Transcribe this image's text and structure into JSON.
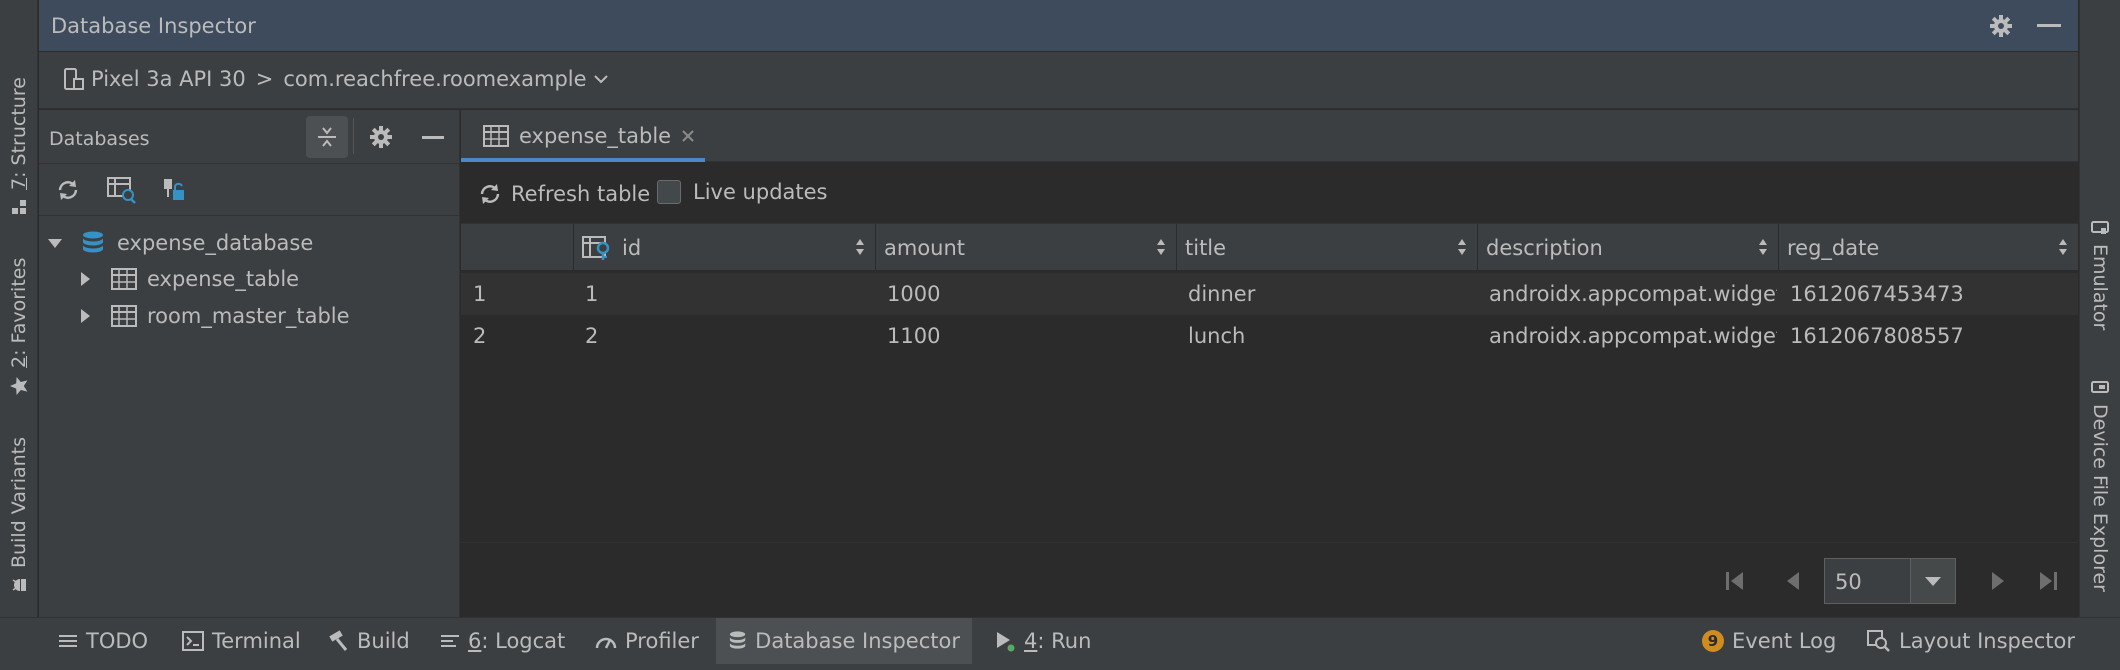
{
  "window": {
    "title": "Database Inspector"
  },
  "left_stripe": {
    "tabs": [
      {
        "num": "7",
        "label": ": Structure",
        "icon": "structure-icon"
      },
      {
        "num": "2",
        "label": ": Favorites",
        "icon": "star-icon"
      },
      {
        "num": "",
        "label": "Build Variants",
        "icon": "android-icon"
      }
    ]
  },
  "right_stripe": {
    "tabs": [
      {
        "label": "Emulator",
        "icon": "emulator-icon"
      },
      {
        "label": "Device File Explorer",
        "icon": "phone-icon"
      }
    ]
  },
  "device_selector": {
    "device": "Pixel 3a API 30",
    "separator": ">",
    "process": "com.reachfree.roomexample"
  },
  "databases_panel": {
    "title": "Databases",
    "tree": {
      "database": "expense_database",
      "tables": [
        "expense_table",
        "room_master_table"
      ]
    }
  },
  "tab": {
    "label": "expense_table"
  },
  "table_toolbar": {
    "refresh_label": "Refresh table",
    "live_updates_label": "Live updates",
    "live_updates_checked": false
  },
  "table": {
    "columns": [
      "id",
      "amount",
      "title",
      "description",
      "reg_date"
    ],
    "rows": [
      {
        "row_num": "1",
        "id": "1",
        "amount": "1000",
        "title": "dinner",
        "description": "androidx.appcompat.widget.Ap",
        "reg_date": "1612067453473"
      },
      {
        "row_num": "2",
        "id": "2",
        "amount": "1100",
        "title": "lunch",
        "description": "androidx.appcompat.widget.Ap",
        "reg_date": "1612067808557"
      }
    ]
  },
  "pager": {
    "page_size": "50"
  },
  "bottom_bar": {
    "todo": "TODO",
    "terminal": "Terminal",
    "build": "Build",
    "logcat_num": "6",
    "logcat_label": ": Logcat",
    "profiler": "Profiler",
    "db_inspector": "Database Inspector",
    "run_num": "4",
    "run_label": ": Run",
    "event_count": "9",
    "event_log": "Event Log",
    "layout_inspector": "Layout Inspector"
  },
  "colors": {
    "accent": "#4a88c7",
    "titlebar": "#3d4b5c",
    "panel": "#3c3f41",
    "editor": "#2b2b2b",
    "text": "#bbbbbb",
    "db_icon": "#3592c4"
  }
}
